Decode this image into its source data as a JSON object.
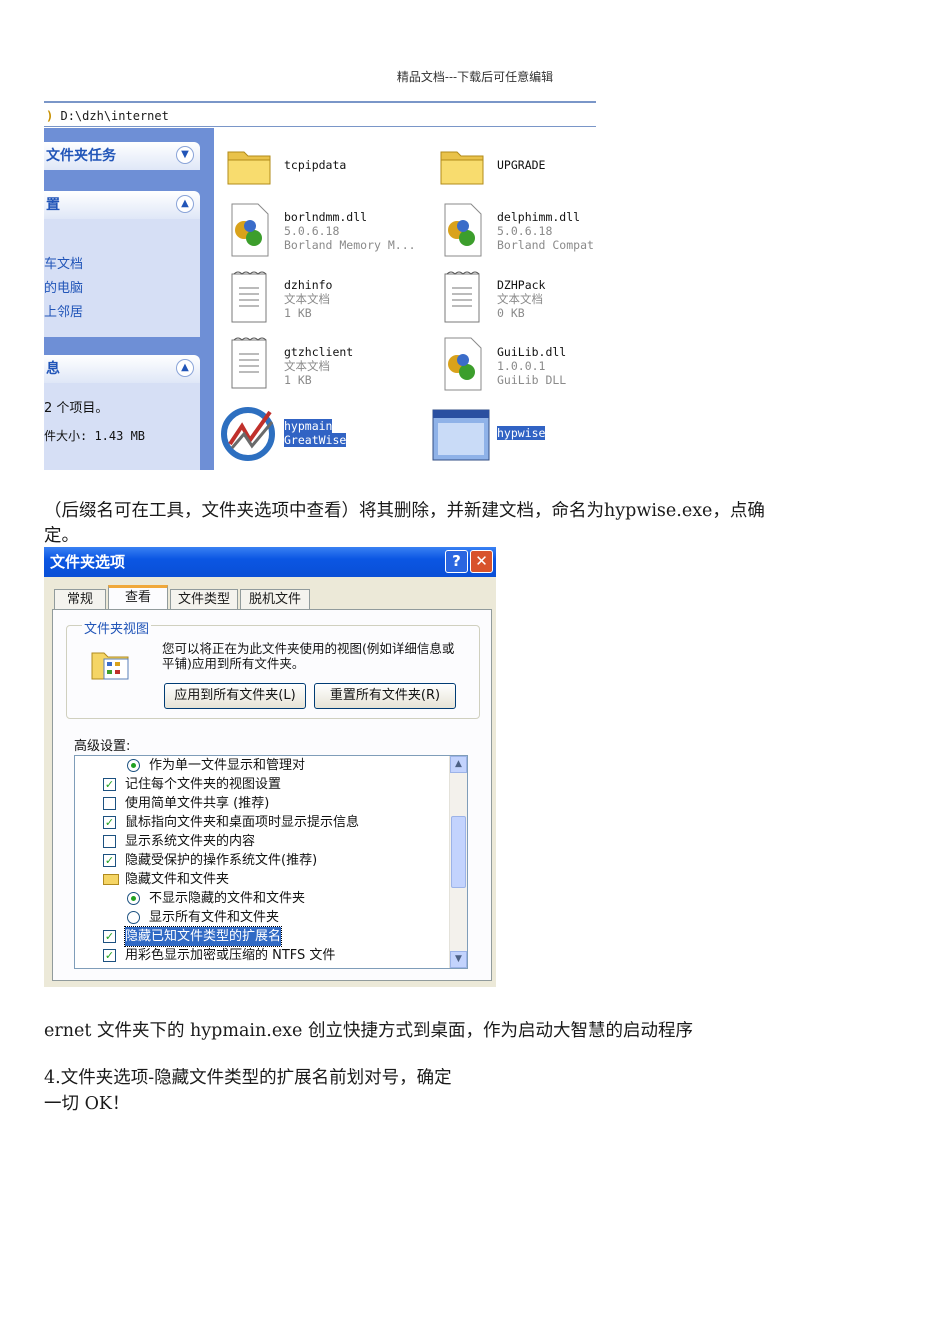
{
  "header": {
    "text": "精品文档---下载后可任意编辑"
  },
  "explorer": {
    "address": "D:\\dzh\\internet",
    "tasks_panel": {
      "title": "文件夹任务"
    },
    "other_panel": {
      "title": "置",
      "links": [
        "车文档",
        "的电脑",
        "上邻居"
      ]
    },
    "details_panel": {
      "title": "息",
      "count": "2 个项目。",
      "size": "件大小: 1.43 MB"
    },
    "files": [
      {
        "name": "tcpipdata",
        "sub1": "",
        "sub2": "",
        "icon": "folder-icon"
      },
      {
        "name": "UPGRADE",
        "sub1": "",
        "sub2": "",
        "icon": "folder-icon"
      },
      {
        "name": "borlndmm.dll",
        "sub1": "5.0.6.18",
        "sub2": "Borland Memory M...",
        "icon": "dll-icon"
      },
      {
        "name": "delphimm.dll",
        "sub1": "5.0.6.18",
        "sub2": "Borland Compat",
        "icon": "dll-icon"
      },
      {
        "name": "dzhinfo",
        "sub1": "文本文档",
        "sub2": "1 KB",
        "icon": "text-file-icon"
      },
      {
        "name": "DZHPack",
        "sub1": "文本文档",
        "sub2": "0 KB",
        "icon": "text-file-icon"
      },
      {
        "name": "gtzhclient",
        "sub1": "文本文档",
        "sub2": "1 KB",
        "icon": "text-file-icon"
      },
      {
        "name": "GuiLib.dll",
        "sub1": "1.0.0.1",
        "sub2": "GuiLib DLL",
        "icon": "dll-icon"
      },
      {
        "name": "hypmain",
        "sub1": "GreatWise",
        "sub2": "",
        "icon": "app-logo-icon"
      },
      {
        "name": "hypwise",
        "sub1": "",
        "sub2": "",
        "icon": "window-app-icon"
      }
    ]
  },
  "paragraphs": {
    "p1_line1": "（后缀名可在工具，文件夹选项中查看）将其删除，并新建文档，命名为hypwise.exe，点确",
    "p1_line2": "定。",
    "p2": "ernet 文件夹下的 hypmain.exe 创立快捷方式到桌面，作为启动大智慧的启动程序",
    "p3_line1": "4.文件夹选项-隐藏文件类型的扩展名前划对号，确定",
    "p3_line2": "一切 OK！"
  },
  "dialog": {
    "title": "文件夹选项",
    "help_label": "?",
    "close_label": "✕",
    "tabs": [
      "常规",
      "查看",
      "文件类型",
      "脱机文件"
    ],
    "active_tab": "查看",
    "folder_views": {
      "title": "文件夹视图",
      "description": "您可以将正在为此文件夹使用的视图(例如详细信息或平铺)应用到所有文件夹。",
      "apply_button": "应用到所有文件夹(L)",
      "reset_button": "重置所有文件夹(R)"
    },
    "advanced_label": "高级设置:",
    "advanced_items": [
      {
        "type": "radio",
        "checked": true,
        "indent": 1,
        "label": "作为单一文件显示和管理对"
      },
      {
        "type": "checkbox",
        "checked": true,
        "indent": 0,
        "label": "记住每个文件夹的视图设置"
      },
      {
        "type": "checkbox",
        "checked": false,
        "indent": 0,
        "label": "使用简单文件共享 (推荐)"
      },
      {
        "type": "checkbox",
        "checked": true,
        "indent": 0,
        "label": "鼠标指向文件夹和桌面项时显示提示信息"
      },
      {
        "type": "checkbox",
        "checked": false,
        "indent": 0,
        "label": "显示系统文件夹的内容"
      },
      {
        "type": "checkbox",
        "checked": true,
        "indent": 0,
        "label": "隐藏受保护的操作系统文件(推荐)"
      },
      {
        "type": "folder",
        "checked": false,
        "indent": 0,
        "label": "隐藏文件和文件夹"
      },
      {
        "type": "radio",
        "checked": true,
        "indent": 1,
        "label": "不显示隐藏的文件和文件夹"
      },
      {
        "type": "radio",
        "checked": false,
        "indent": 1,
        "label": "显示所有文件和文件夹"
      },
      {
        "type": "checkbox",
        "checked": true,
        "indent": 0,
        "label": "隐藏已知文件类型的扩展名",
        "selected": true
      },
      {
        "type": "checkbox",
        "checked": true,
        "indent": 0,
        "label": "用彩色显示加密或压缩的 NTFS 文件"
      }
    ]
  }
}
